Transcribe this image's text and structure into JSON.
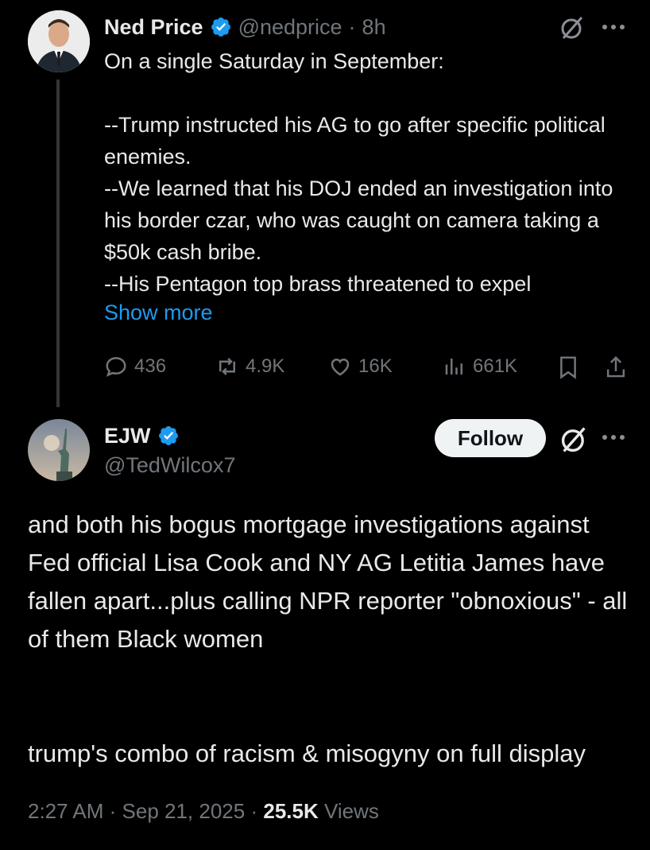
{
  "parent_post": {
    "display_name": "Ned Price",
    "handle": "@nedprice",
    "time": "8h",
    "text": "On a single Saturday in September:\n\n--Trump instructed his AG to go after specific political enemies.\n--We learned that his DOJ ended an investigation into his border czar, who was caught on camera taking a $50k cash bribe.\n--His Pentagon top brass threatened to expel",
    "show_more_label": "Show more",
    "replies": "436",
    "reposts": "4.9K",
    "likes": "16K",
    "views": "661K",
    "icons": [
      "grok-icon",
      "more-icon",
      "reply-icon",
      "repost-icon",
      "like-icon",
      "views-icon",
      "bookmark-icon",
      "share-icon"
    ]
  },
  "reply_post": {
    "display_name": "EJW",
    "handle": "@TedWilcox7",
    "follow_label": "Follow",
    "text": "and both his bogus mortgage investigations against Fed official Lisa Cook and NY AG Letitia James have fallen apart...plus calling NPR reporter \"obnoxious\"  - all of them Black women\n\n\ntrump's combo of racism & misogyny on full display",
    "time": "2:27 AM",
    "date": "Sep 21, 2025",
    "views_count": "25.5K",
    "views_label": "Views"
  },
  "colors": {
    "background": "#000000",
    "text": "#e7e9ea",
    "muted": "#71767b",
    "link": "#1d9bf0",
    "verified": "#1d9bf0"
  }
}
